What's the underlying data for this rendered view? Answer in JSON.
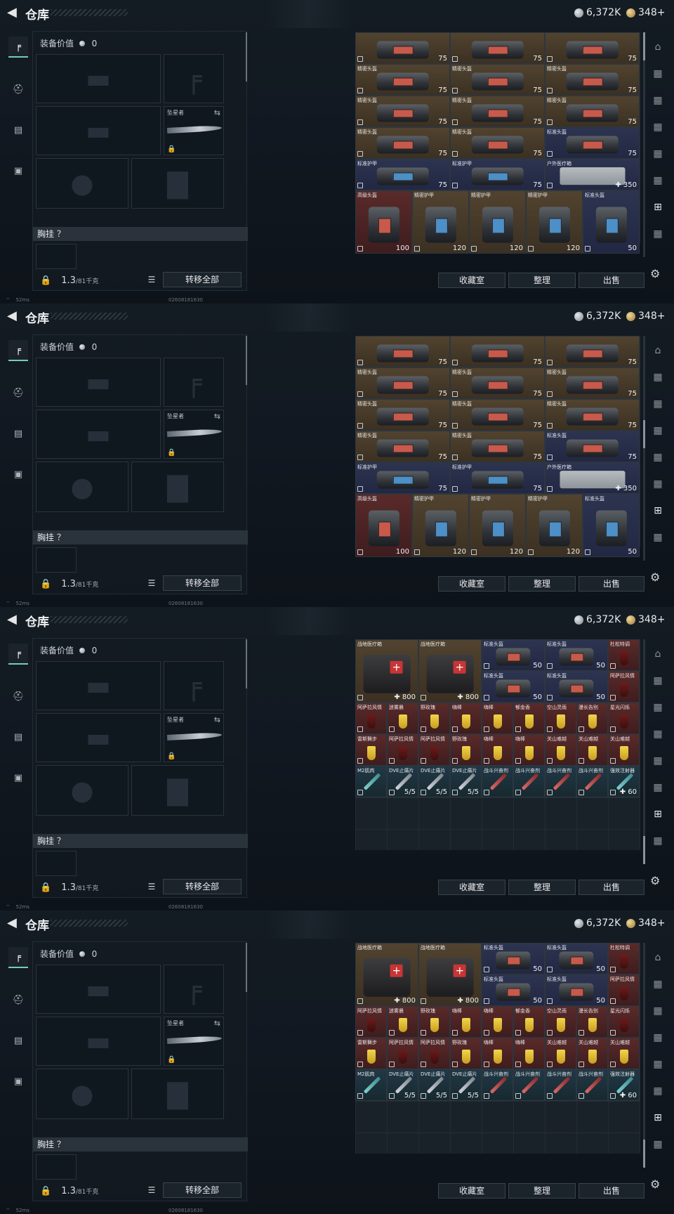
{
  "header": {
    "title": "仓库",
    "silver": "6,372K",
    "gold": "348+"
  },
  "left": {
    "equip_label": "装备价值",
    "equip_value": "0",
    "melee_name": "坠星者",
    "section_label": "胸挂 ？",
    "weight": "1.3",
    "weight_max": "/81千克",
    "transfer_btn": "转移全部"
  },
  "actions": {
    "collect": "收藏室",
    "organize": "整理",
    "sell": "出售"
  },
  "status": {
    "ping": "52ms",
    "uid": "02608181630"
  },
  "panelA": [
    {
      "name": "",
      "val": "75",
      "c": "brown",
      "t": "bag",
      "x": 0,
      "y": 0,
      "w": 1,
      "h": 1
    },
    {
      "name": "",
      "val": "75",
      "c": "brown",
      "t": "bag",
      "x": 1,
      "y": 0,
      "w": 1,
      "h": 1
    },
    {
      "name": "",
      "val": "75",
      "c": "brown",
      "t": "bag",
      "x": 2,
      "y": 0,
      "w": 1,
      "h": 1
    },
    {
      "name": "精密头盔",
      "val": "75",
      "c": "brown",
      "t": "bag",
      "x": 0,
      "y": 1,
      "w": 1,
      "h": 1
    },
    {
      "name": "精密头盔",
      "val": "75",
      "c": "brown",
      "t": "bag",
      "x": 1,
      "y": 1,
      "w": 1,
      "h": 1
    },
    {
      "name": "精密头盔",
      "val": "75",
      "c": "brown",
      "t": "bag",
      "x": 2,
      "y": 1,
      "w": 1,
      "h": 1
    },
    {
      "name": "精密头盔",
      "val": "75",
      "c": "brown",
      "t": "bag",
      "x": 0,
      "y": 2,
      "w": 1,
      "h": 1
    },
    {
      "name": "精密头盔",
      "val": "75",
      "c": "brown",
      "t": "bag",
      "x": 1,
      "y": 2,
      "w": 1,
      "h": 1
    },
    {
      "name": "精密头盔",
      "val": "75",
      "c": "brown",
      "t": "bag",
      "x": 2,
      "y": 2,
      "w": 1,
      "h": 1
    },
    {
      "name": "精密头盔",
      "val": "75",
      "c": "brown",
      "t": "bag",
      "x": 0,
      "y": 3,
      "w": 1,
      "h": 1
    },
    {
      "name": "精密头盔",
      "val": "75",
      "c": "brown",
      "t": "bag",
      "x": 1,
      "y": 3,
      "w": 1,
      "h": 1
    },
    {
      "name": "标准头盔",
      "val": "75",
      "c": "blue",
      "t": "bag",
      "x": 2,
      "y": 3,
      "w": 1,
      "h": 1
    },
    {
      "name": "标准护甲",
      "val": "75",
      "c": "blue",
      "t": "bagb",
      "x": 0,
      "y": 4,
      "w": 1,
      "h": 1
    },
    {
      "name": "标准护甲",
      "val": "75",
      "c": "blue",
      "t": "bagb",
      "x": 1,
      "y": 4,
      "w": 1,
      "h": 1
    },
    {
      "name": "户外医疗箱",
      "val": "✚ 350",
      "c": "blue",
      "t": "pad",
      "x": 2,
      "y": 4,
      "w": 1,
      "h": 1
    },
    {
      "name": "高级头盔",
      "val": "100",
      "c": "red",
      "t": "bag",
      "x": 0,
      "y": 5,
      "w": 0.6,
      "h": 2
    },
    {
      "name": "精密护甲",
      "val": "120",
      "c": "brown",
      "t": "bagb",
      "x": 0.6,
      "y": 5,
      "w": 0.6,
      "h": 2
    },
    {
      "name": "精密护甲",
      "val": "120",
      "c": "brown",
      "t": "bagb",
      "x": 1.2,
      "y": 5,
      "w": 0.6,
      "h": 2
    },
    {
      "name": "精密护甲",
      "val": "120",
      "c": "brown",
      "t": "bagb",
      "x": 1.8,
      "y": 5,
      "w": 0.6,
      "h": 2
    },
    {
      "name": "标准头盔",
      "val": "50",
      "c": "blue",
      "t": "bagb",
      "x": 2.4,
      "y": 5,
      "w": 0.6,
      "h": 2
    }
  ],
  "panelC": [
    {
      "name": "战地医疗箱",
      "val": "✚ 800",
      "c": "brown",
      "t": "med",
      "x": 0,
      "y": 0,
      "w": 2,
      "h": 2
    },
    {
      "name": "战地医疗箱",
      "val": "✚ 800",
      "c": "brown",
      "t": "med",
      "x": 2,
      "y": 0,
      "w": 2,
      "h": 2
    },
    {
      "name": "标准头盔",
      "val": "50",
      "c": "blue",
      "t": "bag",
      "x": 4,
      "y": 0,
      "w": 2,
      "h": 1
    },
    {
      "name": "标准头盔",
      "val": "50",
      "c": "blue",
      "t": "bag",
      "x": 6,
      "y": 0,
      "w": 2,
      "h": 1
    },
    {
      "name": "杜松特调",
      "val": "",
      "c": "red",
      "t": "drinkd",
      "x": 8,
      "y": 0,
      "w": 1,
      "h": 1
    },
    {
      "name": "标准头盔",
      "val": "50",
      "c": "blue",
      "t": "bag",
      "x": 4,
      "y": 1,
      "w": 2,
      "h": 1
    },
    {
      "name": "标准头盔",
      "val": "50",
      "c": "blue",
      "t": "bag",
      "x": 6,
      "y": 1,
      "w": 2,
      "h": 1
    },
    {
      "name": "阿萨拉风情",
      "val": "",
      "c": "red",
      "t": "drinkd",
      "x": 8,
      "y": 1,
      "w": 1,
      "h": 1
    },
    {
      "name": "阿萨拉风情",
      "val": "",
      "c": "red",
      "t": "drinkd",
      "x": 0,
      "y": 2,
      "w": 1,
      "h": 1
    },
    {
      "name": "迷雾晨",
      "val": "",
      "c": "red",
      "t": "drink",
      "x": 1,
      "y": 2,
      "w": 1,
      "h": 1
    },
    {
      "name": "野玫瑰",
      "val": "",
      "c": "red",
      "t": "drink",
      "x": 2,
      "y": 2,
      "w": 1,
      "h": 1
    },
    {
      "name": "嗨棒",
      "val": "",
      "c": "red",
      "t": "drink",
      "x": 3,
      "y": 2,
      "w": 1,
      "h": 1
    },
    {
      "name": "嗨棒",
      "val": "",
      "c": "red",
      "t": "drink",
      "x": 4,
      "y": 2,
      "w": 1,
      "h": 1
    },
    {
      "name": "郁金香",
      "val": "",
      "c": "red",
      "t": "drink",
      "x": 5,
      "y": 2,
      "w": 1,
      "h": 1
    },
    {
      "name": "空山灵雨",
      "val": "",
      "c": "red",
      "t": "drink",
      "x": 6,
      "y": 2,
      "w": 1,
      "h": 1
    },
    {
      "name": "漫长告别",
      "val": "",
      "c": "red",
      "t": "drink",
      "x": 7,
      "y": 2,
      "w": 1,
      "h": 1
    },
    {
      "name": "星光闪烁",
      "val": "",
      "c": "red",
      "t": "drinkd",
      "x": 8,
      "y": 2,
      "w": 1,
      "h": 1
    },
    {
      "name": "雷斯舞步",
      "val": "",
      "c": "red",
      "t": "drink",
      "x": 0,
      "y": 3,
      "w": 1,
      "h": 1
    },
    {
      "name": "阿萨拉风情",
      "val": "",
      "c": "red",
      "t": "drinkd",
      "x": 1,
      "y": 3,
      "w": 1,
      "h": 1
    },
    {
      "name": "阿萨拉风情",
      "val": "",
      "c": "red",
      "t": "drinkd",
      "x": 2,
      "y": 3,
      "w": 1,
      "h": 1
    },
    {
      "name": "野玫瑰",
      "val": "",
      "c": "red",
      "t": "drink",
      "x": 3,
      "y": 3,
      "w": 1,
      "h": 1
    },
    {
      "name": "嗨棒",
      "val": "",
      "c": "red",
      "t": "drink",
      "x": 4,
      "y": 3,
      "w": 1,
      "h": 1
    },
    {
      "name": "嗨棒",
      "val": "",
      "c": "red",
      "t": "drink",
      "x": 5,
      "y": 3,
      "w": 1,
      "h": 1
    },
    {
      "name": "关山难越",
      "val": "",
      "c": "red",
      "t": "drink",
      "x": 6,
      "y": 3,
      "w": 1,
      "h": 1
    },
    {
      "name": "关山难越",
      "val": "",
      "c": "red",
      "t": "drink",
      "x": 7,
      "y": 3,
      "w": 1,
      "h": 1
    },
    {
      "name": "关山难越",
      "val": "",
      "c": "red",
      "t": "drink",
      "x": 8,
      "y": 3,
      "w": 1,
      "h": 1
    },
    {
      "name": "M2肌肉",
      "val": "",
      "c": "teal",
      "t": "syrt",
      "x": 0,
      "y": 4,
      "w": 1,
      "h": 1
    },
    {
      "name": "DVE止痛片",
      "val": "5/5",
      "c": "teal",
      "t": "syr",
      "x": 1,
      "y": 4,
      "w": 1,
      "h": 1
    },
    {
      "name": "DVE止痛片",
      "val": "5/5",
      "c": "teal",
      "t": "syr",
      "x": 2,
      "y": 4,
      "w": 1,
      "h": 1
    },
    {
      "name": "DVE止痛片",
      "val": "5/5",
      "c": "teal",
      "t": "syr",
      "x": 3,
      "y": 4,
      "w": 1,
      "h": 1
    },
    {
      "name": "战斗兴奋剂",
      "val": "",
      "c": "teal",
      "t": "syrr",
      "x": 4,
      "y": 4,
      "w": 1,
      "h": 1
    },
    {
      "name": "战斗兴奋剂",
      "val": "",
      "c": "teal",
      "t": "syrr",
      "x": 5,
      "y": 4,
      "w": 1,
      "h": 1
    },
    {
      "name": "战斗兴奋剂",
      "val": "",
      "c": "teal",
      "t": "syrr",
      "x": 6,
      "y": 4,
      "w": 1,
      "h": 1
    },
    {
      "name": "战斗兴奋剂",
      "val": "",
      "c": "teal",
      "t": "syrr",
      "x": 7,
      "y": 4,
      "w": 1,
      "h": 1
    },
    {
      "name": "强效注射器",
      "val": "✚ 60",
      "c": "teal",
      "t": "syrt",
      "x": 8,
      "y": 4,
      "w": 1,
      "h": 1
    }
  ]
}
